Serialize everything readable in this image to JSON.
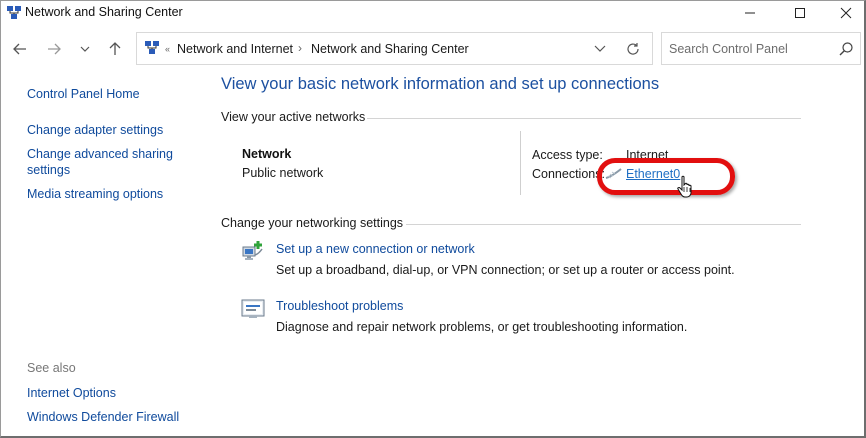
{
  "window": {
    "title": "Network and Sharing Center",
    "icon": "network-icon"
  },
  "addressbar": {
    "breadcrumb": [
      "Network and Internet",
      "Network and Sharing Center"
    ],
    "separator": "›",
    "overflow": "«"
  },
  "search": {
    "placeholder": "Search Control Panel"
  },
  "leftnav": {
    "home": "Control Panel Home",
    "links": [
      "Change adapter settings",
      "Change advanced sharing settings",
      "Media streaming options"
    ],
    "see_also_label": "See also",
    "see_also": [
      "Internet Options",
      "Windows Defender Firewall"
    ]
  },
  "main": {
    "title": "View your basic network information and set up connections",
    "active_networks_header": "View your active networks",
    "network": {
      "name": "Network",
      "type": "Public network",
      "access_type_label": "Access type:",
      "access_type_value": "Internet",
      "connections_label": "Connections:",
      "connection_name": "Ethernet0"
    },
    "change_header": "Change your networking settings",
    "tasks": [
      {
        "icon": "new-connection-icon",
        "link": "Set up a new connection or network",
        "desc": "Set up a broadband, dial-up, or VPN connection; or set up a router or access point."
      },
      {
        "icon": "troubleshoot-icon",
        "link": "Troubleshoot problems",
        "desc": "Diagnose and repair network problems, or get troubleshooting information."
      }
    ]
  },
  "colors": {
    "link": "#0f4a9c",
    "title": "#1c50a0",
    "highlight": "#e20f0f"
  }
}
